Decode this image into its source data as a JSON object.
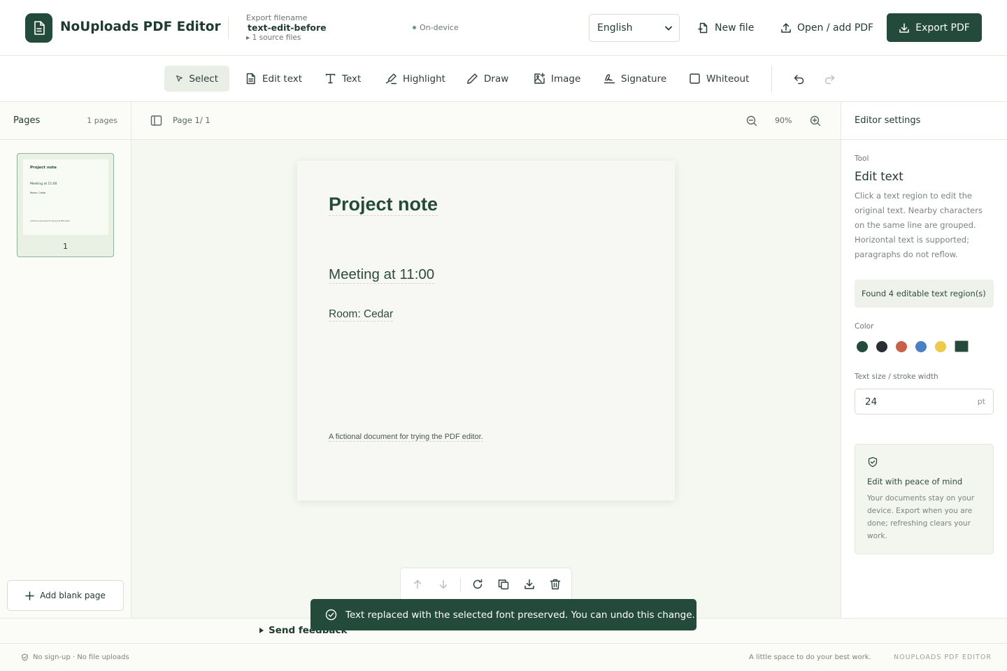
{
  "header": {
    "app_title": "NoUploads PDF Editor",
    "filename_label": "Export filename",
    "filename_value": "text-edit-before",
    "source_files": "▸ 1 source files",
    "status": "On-device",
    "language": "English",
    "new_file": "New file",
    "open_add": "Open / add PDF",
    "export": "Export PDF"
  },
  "toolbar": {
    "tools": [
      "Select",
      "Edit text",
      "Text",
      "Highlight",
      "Draw",
      "Image",
      "Signature",
      "Whiteout"
    ],
    "active_tool": "Select"
  },
  "pages": {
    "title": "Pages",
    "count": "1 pages",
    "thumbnail_number": "1",
    "add_blank": "Add blank page"
  },
  "canvas": {
    "page_indicator": "Page 1/ 1",
    "zoom": "90%"
  },
  "document": {
    "title": "Project note",
    "meeting": "Meeting at 11:00",
    "room": "Room: Cedar",
    "footer": "A fictional document for trying the PDF editor."
  },
  "toast": {
    "message": "Text replaced with the selected font preserved. You can undo this change."
  },
  "settings": {
    "title": "Editor settings",
    "tool_label": "Tool",
    "tool_name": "Edit text",
    "tool_description": "Click a text region to edit the original text. Nearby characters on the same line are grouped. Horizontal text is supported; paragraphs do not reflow.",
    "found": "Found 4 editable text region(s)",
    "color_label": "Color",
    "colors": [
      "#234a3a",
      "#2a2d33",
      "#c9614a",
      "#4a7fc3",
      "#eec94a",
      "#234a3a"
    ],
    "size_label": "Text size / stroke width",
    "size_value": "24",
    "size_unit": "pt",
    "peace_title": "Edit with peace of mind",
    "peace_desc": "Your documents stay on your device. Export when you are done; refreshing clears your work."
  },
  "feedback": "Send feedback",
  "footer": {
    "left": "No sign-up · No file uploads",
    "right": "A little space to do your best work.",
    "brand": "NOUPLOADS PDF EDITOR"
  }
}
